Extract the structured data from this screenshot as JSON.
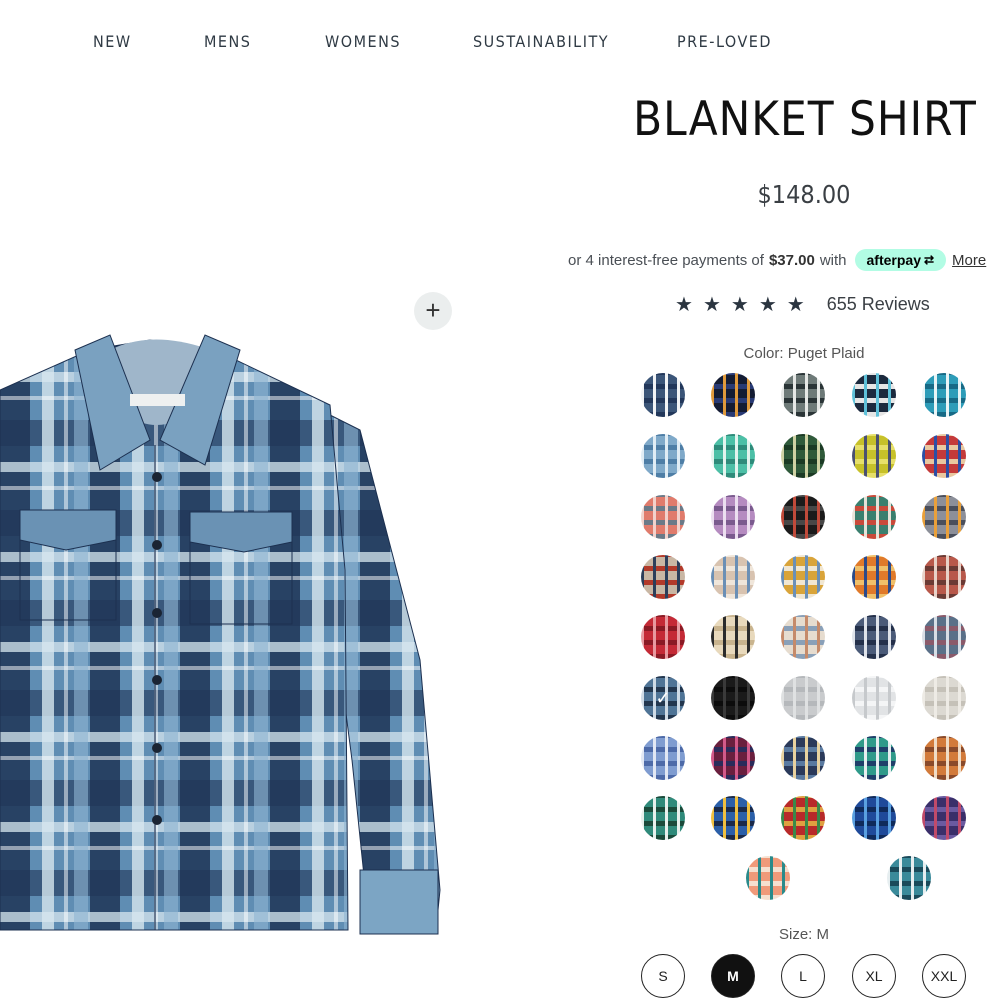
{
  "nav": {
    "items": [
      "NEW",
      "MENS",
      "WOMENS",
      "SUSTAINABILITY",
      "PRE-LOVED"
    ]
  },
  "product": {
    "title": "BLANKET SHIRT",
    "price": "$148.00",
    "afterpay": {
      "prefix": "or 4 interest-free payments of",
      "amount": "$37.00",
      "with": "with",
      "brand": "afterpay",
      "more": "More"
    },
    "rating_stars": 5,
    "reviews": "655 Reviews",
    "color_label": "Color: Puget Plaid",
    "selected_color_index": 25,
    "size_label": "Size: M",
    "sizes": [
      "S",
      "M",
      "L",
      "XL",
      "XXL"
    ],
    "selected_size": "M"
  },
  "icons": {
    "zoom": "plus-icon",
    "star": "star-icon",
    "check": "check-icon",
    "afterpay": "afterpay-arrows-icon"
  },
  "colors": {
    "afterpay_mint": "#b2fce4",
    "selected_size_bg": "#111111",
    "swatches": [
      [
        "#3b5578",
        "#f1f3f5",
        "#22375a"
      ],
      [
        "#141c33",
        "#e09a3c",
        "#283a74"
      ],
      [
        "#6e7a78",
        "#e6e8e6",
        "#2a3436"
      ],
      [
        "#1c2a3e",
        "#5ec0d8",
        "#e6e6e6"
      ],
      [
        "#2d9cb8",
        "#e8f4f6",
        "#176a86"
      ],
      [
        "#7fa9c9",
        "#e1edf5",
        "#4e7ea6"
      ],
      [
        "#4cbfa6",
        "#e3f4ee",
        "#2e8b7a"
      ],
      [
        "#2f5a3a",
        "#cfd2a4",
        "#1b3a24"
      ],
      [
        "#c7c12a",
        "#4a5070",
        "#e7e06a"
      ],
      [
        "#c43a3a",
        "#2b4fa6",
        "#e9c8a0"
      ],
      [
        "#e07b6c",
        "#f2d2cc",
        "#6b7a88"
      ],
      [
        "#b58bc0",
        "#ecdff0",
        "#7a5a8e"
      ],
      [
        "#1b1b1b",
        "#c04a3a",
        "#474747"
      ],
      [
        "#3a7f6e",
        "#e8e3d8",
        "#c94a3a"
      ],
      [
        "#8c8f99",
        "#e9a03a",
        "#4a4f5c"
      ],
      [
        "#c9b7a4",
        "#2c3e5a",
        "#b33a2a"
      ],
      [
        "#d8c3b0",
        "#6b8fb5",
        "#f0e6da"
      ],
      [
        "#d9a43a",
        "#6b90b8",
        "#f1e7d2"
      ],
      [
        "#e07a2a",
        "#2b4a8a",
        "#f0c06a"
      ],
      [
        "#b8584a",
        "#e9d2c8",
        "#6b3a34"
      ],
      [
        "#c42a36",
        "#e89aa0",
        "#8a1a24"
      ],
      [
        "#e8d9bc",
        "#2b2b2b",
        "#c9b48e"
      ],
      [
        "#e6dccf",
        "#c58a6a",
        "#8aa0b8"
      ],
      [
        "#4a5a78",
        "#dfe3ea",
        "#24304a"
      ],
      [
        "#5a7088",
        "#d8dee5",
        "#8a5a6a"
      ],
      [
        "#4f7496",
        "#cfdbe6",
        "#22364e"
      ],
      [
        "#1a1a1a",
        "#3a3a3a",
        "#0c0c0c"
      ],
      [
        "#c9cbcd",
        "#dfe1e2",
        "#b5b8bb"
      ],
      [
        "#e1e3e5",
        "#c6c9cc",
        "#f4f5f6"
      ],
      [
        "#dcd9d2",
        "#eeebe5",
        "#c5c1b8"
      ],
      [
        "#7f9cd0",
        "#e2e8f4",
        "#4d6aa8"
      ],
      [
        "#6a1f3e",
        "#d25a8a",
        "#2a2b5a"
      ],
      [
        "#2b3a5a",
        "#e8d2a0",
        "#5a7aa0"
      ],
      [
        "#2f9a8a",
        "#e6eef0",
        "#1f3f6a"
      ],
      [
        "#d27a3a",
        "#f0dcc6",
        "#8a4a2a"
      ],
      [
        "#2f8a7a",
        "#e6f0ec",
        "#1a4a3a"
      ],
      [
        "#2b5fa8",
        "#f0c040",
        "#1a2a4a"
      ],
      [
        "#b82a2a",
        "#3a8a4a",
        "#e0a040"
      ],
      [
        "#1f4a9a",
        "#5aa0e0",
        "#0f2a5a"
      ],
      [
        "#3a2f6a",
        "#c04a6a",
        "#6a5aa0"
      ],
      [
        "#f09a7a",
        "#2a8a8a",
        "#f6e0d0"
      ],
      [
        "#3a8a9a",
        "#e6eef0",
        "#1a4a5a"
      ]
    ]
  }
}
